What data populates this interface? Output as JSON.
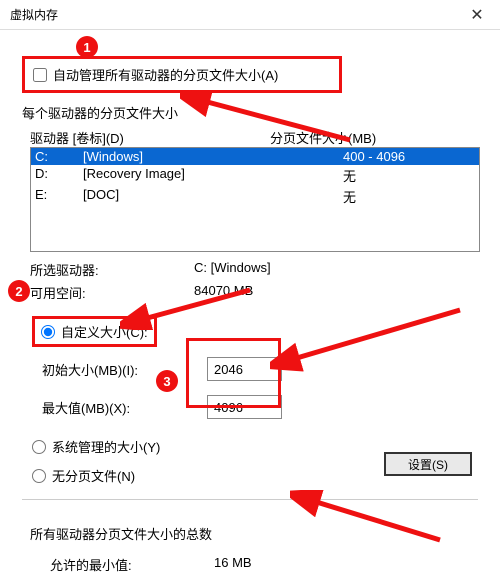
{
  "window": {
    "title": "虚拟内存"
  },
  "auto_manage": {
    "label": "自动管理所有驱动器的分页文件大小(A)"
  },
  "per_drive_label": "每个驱动器的分页文件大小",
  "cols": {
    "drive": "驱动器 [卷标](D)",
    "size": "分页文件大小(MB)"
  },
  "drives": [
    {
      "letter": "C:",
      "label": "[Windows]",
      "size": "400 - 4096",
      "selected": true
    },
    {
      "letter": "D:",
      "label": "[Recovery Image]",
      "size": "无",
      "selected": false
    },
    {
      "letter": "E:",
      "label": "[DOC]",
      "size": "无",
      "selected": false
    }
  ],
  "selected_drive": {
    "label": "所选驱动器:",
    "value": "C:  [Windows]"
  },
  "free_space": {
    "label": "可用空间:",
    "value": "84070 MB"
  },
  "radio": {
    "custom": "自定义大小(C):",
    "system": "系统管理的大小(Y)",
    "none": "无分页文件(N)"
  },
  "initial": {
    "label": "初始大小(MB)(I):",
    "value": "2046"
  },
  "max": {
    "label": "最大值(MB)(X):",
    "value": "4096"
  },
  "set_button": "设置(S)",
  "total_label": "所有驱动器分页文件大小的总数",
  "allowed_min": {
    "label": "允许的最小值:",
    "value": "16 MB"
  },
  "badges": {
    "one": "1",
    "two": "2",
    "three": "3"
  }
}
